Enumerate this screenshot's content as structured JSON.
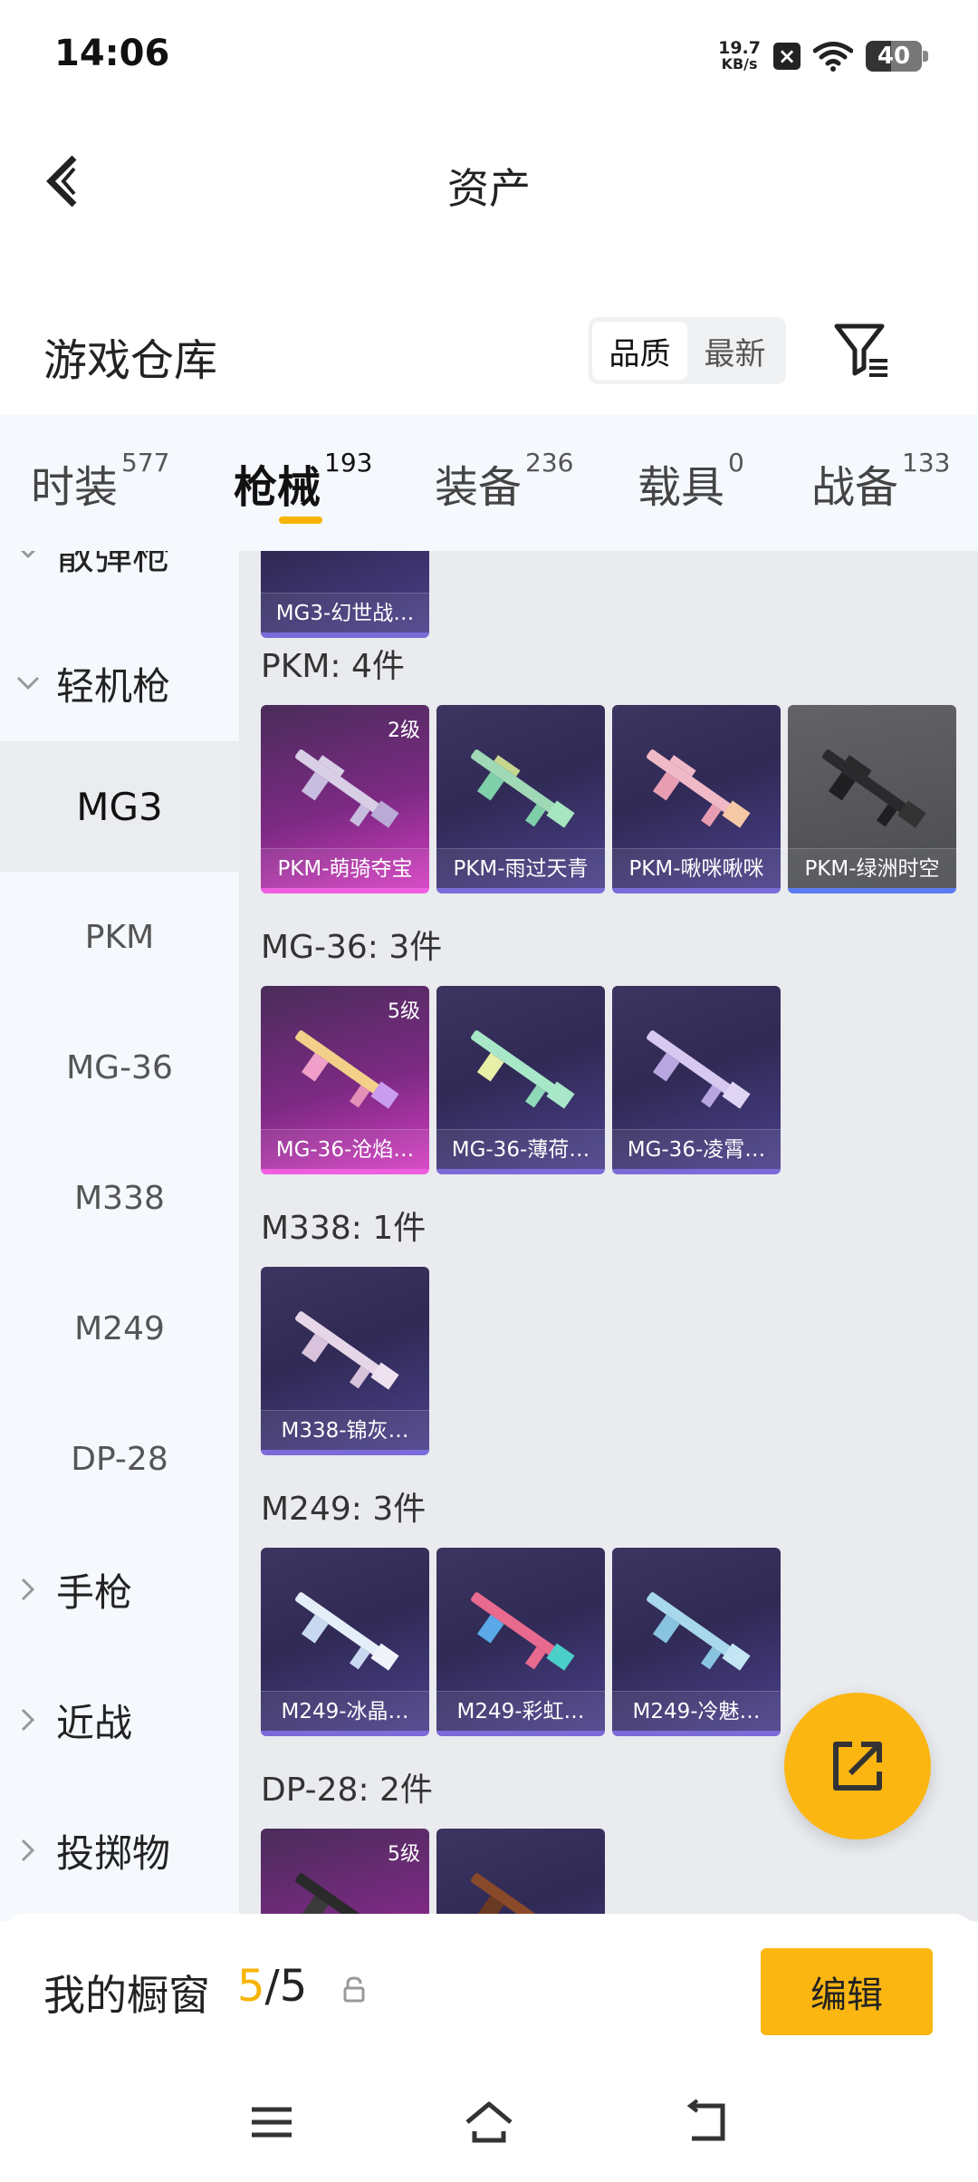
{
  "status_bar": {
    "time": "14:06",
    "speed_value": "19.7",
    "speed_unit": "KB/s",
    "battery": "40"
  },
  "header": {
    "title": "资产"
  },
  "section": {
    "title": "游戏仓库",
    "sort_options": [
      "品质",
      "最新"
    ],
    "active_sort": "品质"
  },
  "tabs": [
    {
      "label": "时装",
      "count": "577"
    },
    {
      "label": "枪械",
      "count": "193"
    },
    {
      "label": "装备",
      "count": "236"
    },
    {
      "label": "载具",
      "count": "0"
    },
    {
      "label": "战备",
      "count": "133"
    }
  ],
  "active_tab": "枪械",
  "sidebar": {
    "partial_top": "散弹枪",
    "expanded_category": "轻机枪",
    "subitems": [
      "MG3",
      "PKM",
      "MG-36",
      "M338",
      "M249",
      "DP-28"
    ],
    "selected_subitem": "MG3",
    "collapsed_categories": [
      "手枪",
      "近战",
      "投掷物"
    ]
  },
  "content": {
    "top_partial": {
      "name": "MG3-幻世战…"
    },
    "groups": [
      {
        "label": "PKM: 4件",
        "items": [
          {
            "name": "PKM-萌骑夺宝",
            "level": "2级",
            "rarity": "pink"
          },
          {
            "name": "PKM-雨过天青",
            "level": "",
            "rarity": "purple"
          },
          {
            "name": "PKM-啾咪啾咪",
            "level": "",
            "rarity": "purple"
          },
          {
            "name": "PKM-绿洲时空",
            "level": "",
            "rarity": "gray"
          }
        ]
      },
      {
        "label": "MG-36: 3件",
        "items": [
          {
            "name": "MG-36-沧焰…",
            "level": "5级",
            "rarity": "pink"
          },
          {
            "name": "MG-36-薄荷…",
            "level": "",
            "rarity": "purple"
          },
          {
            "name": "MG-36-凌霄…",
            "level": "",
            "rarity": "purple"
          }
        ]
      },
      {
        "label": "M338: 1件",
        "items": [
          {
            "name": "M338-锦灰…",
            "level": "",
            "rarity": "purple"
          }
        ]
      },
      {
        "label": "M249: 3件",
        "items": [
          {
            "name": "M249-冰晶…",
            "level": "",
            "rarity": "purple"
          },
          {
            "name": "M249-彩虹…",
            "level": "",
            "rarity": "purple"
          },
          {
            "name": "M249-冷魅…",
            "level": "",
            "rarity": "purple"
          }
        ]
      },
      {
        "label": "DP-28: 2件",
        "items": [
          {
            "name": "",
            "level": "5级",
            "rarity": "pink"
          },
          {
            "name": "",
            "level": "",
            "rarity": "purple"
          }
        ]
      }
    ]
  },
  "showcase": {
    "label": "我的橱窗",
    "current": "5",
    "total": "/5",
    "edit_label": "编辑"
  },
  "colors": {
    "accent": "#fbb612",
    "pink_rarity": "#d23cc0",
    "purple_rarity": "#4a3f8a"
  }
}
